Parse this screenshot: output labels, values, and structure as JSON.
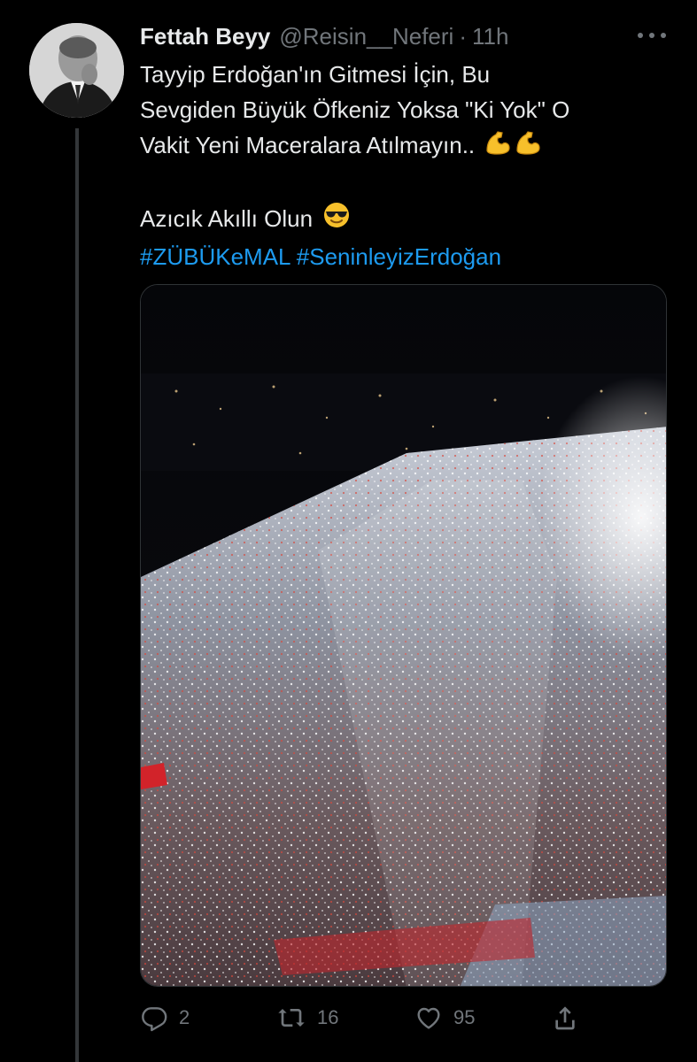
{
  "tweet": {
    "display_name": "Fettah Beyy",
    "handle": "@Reisin__Neferi",
    "separator": "·",
    "time": "11h",
    "text_lines": [
      "Tayyip Erdoğan'ın Gitmesi İçin, Bu",
      "Sevgiden Büyük Öfkeniz Yoksa \"Ki Yok\" O",
      "Vakit Yeni Maceralara Atılmayın.."
    ],
    "text_line_2": "Azıcık Akıllı Olun",
    "hashtags": [
      "#ZÜBÜKeMAL",
      "#SeninleyizErdoğan"
    ],
    "emojis": [
      "flexed-biceps-emoji",
      "flexed-biceps-emoji",
      "smiling-face-with-sunglasses-emoji"
    ]
  },
  "stats": {
    "replies": "2",
    "retweets": "16",
    "likes": "95"
  },
  "colors": {
    "background": "#000000",
    "text": "#e7e9ea",
    "secondary": "#71767b",
    "link": "#1d9bf0",
    "thread_line": "#333639"
  }
}
